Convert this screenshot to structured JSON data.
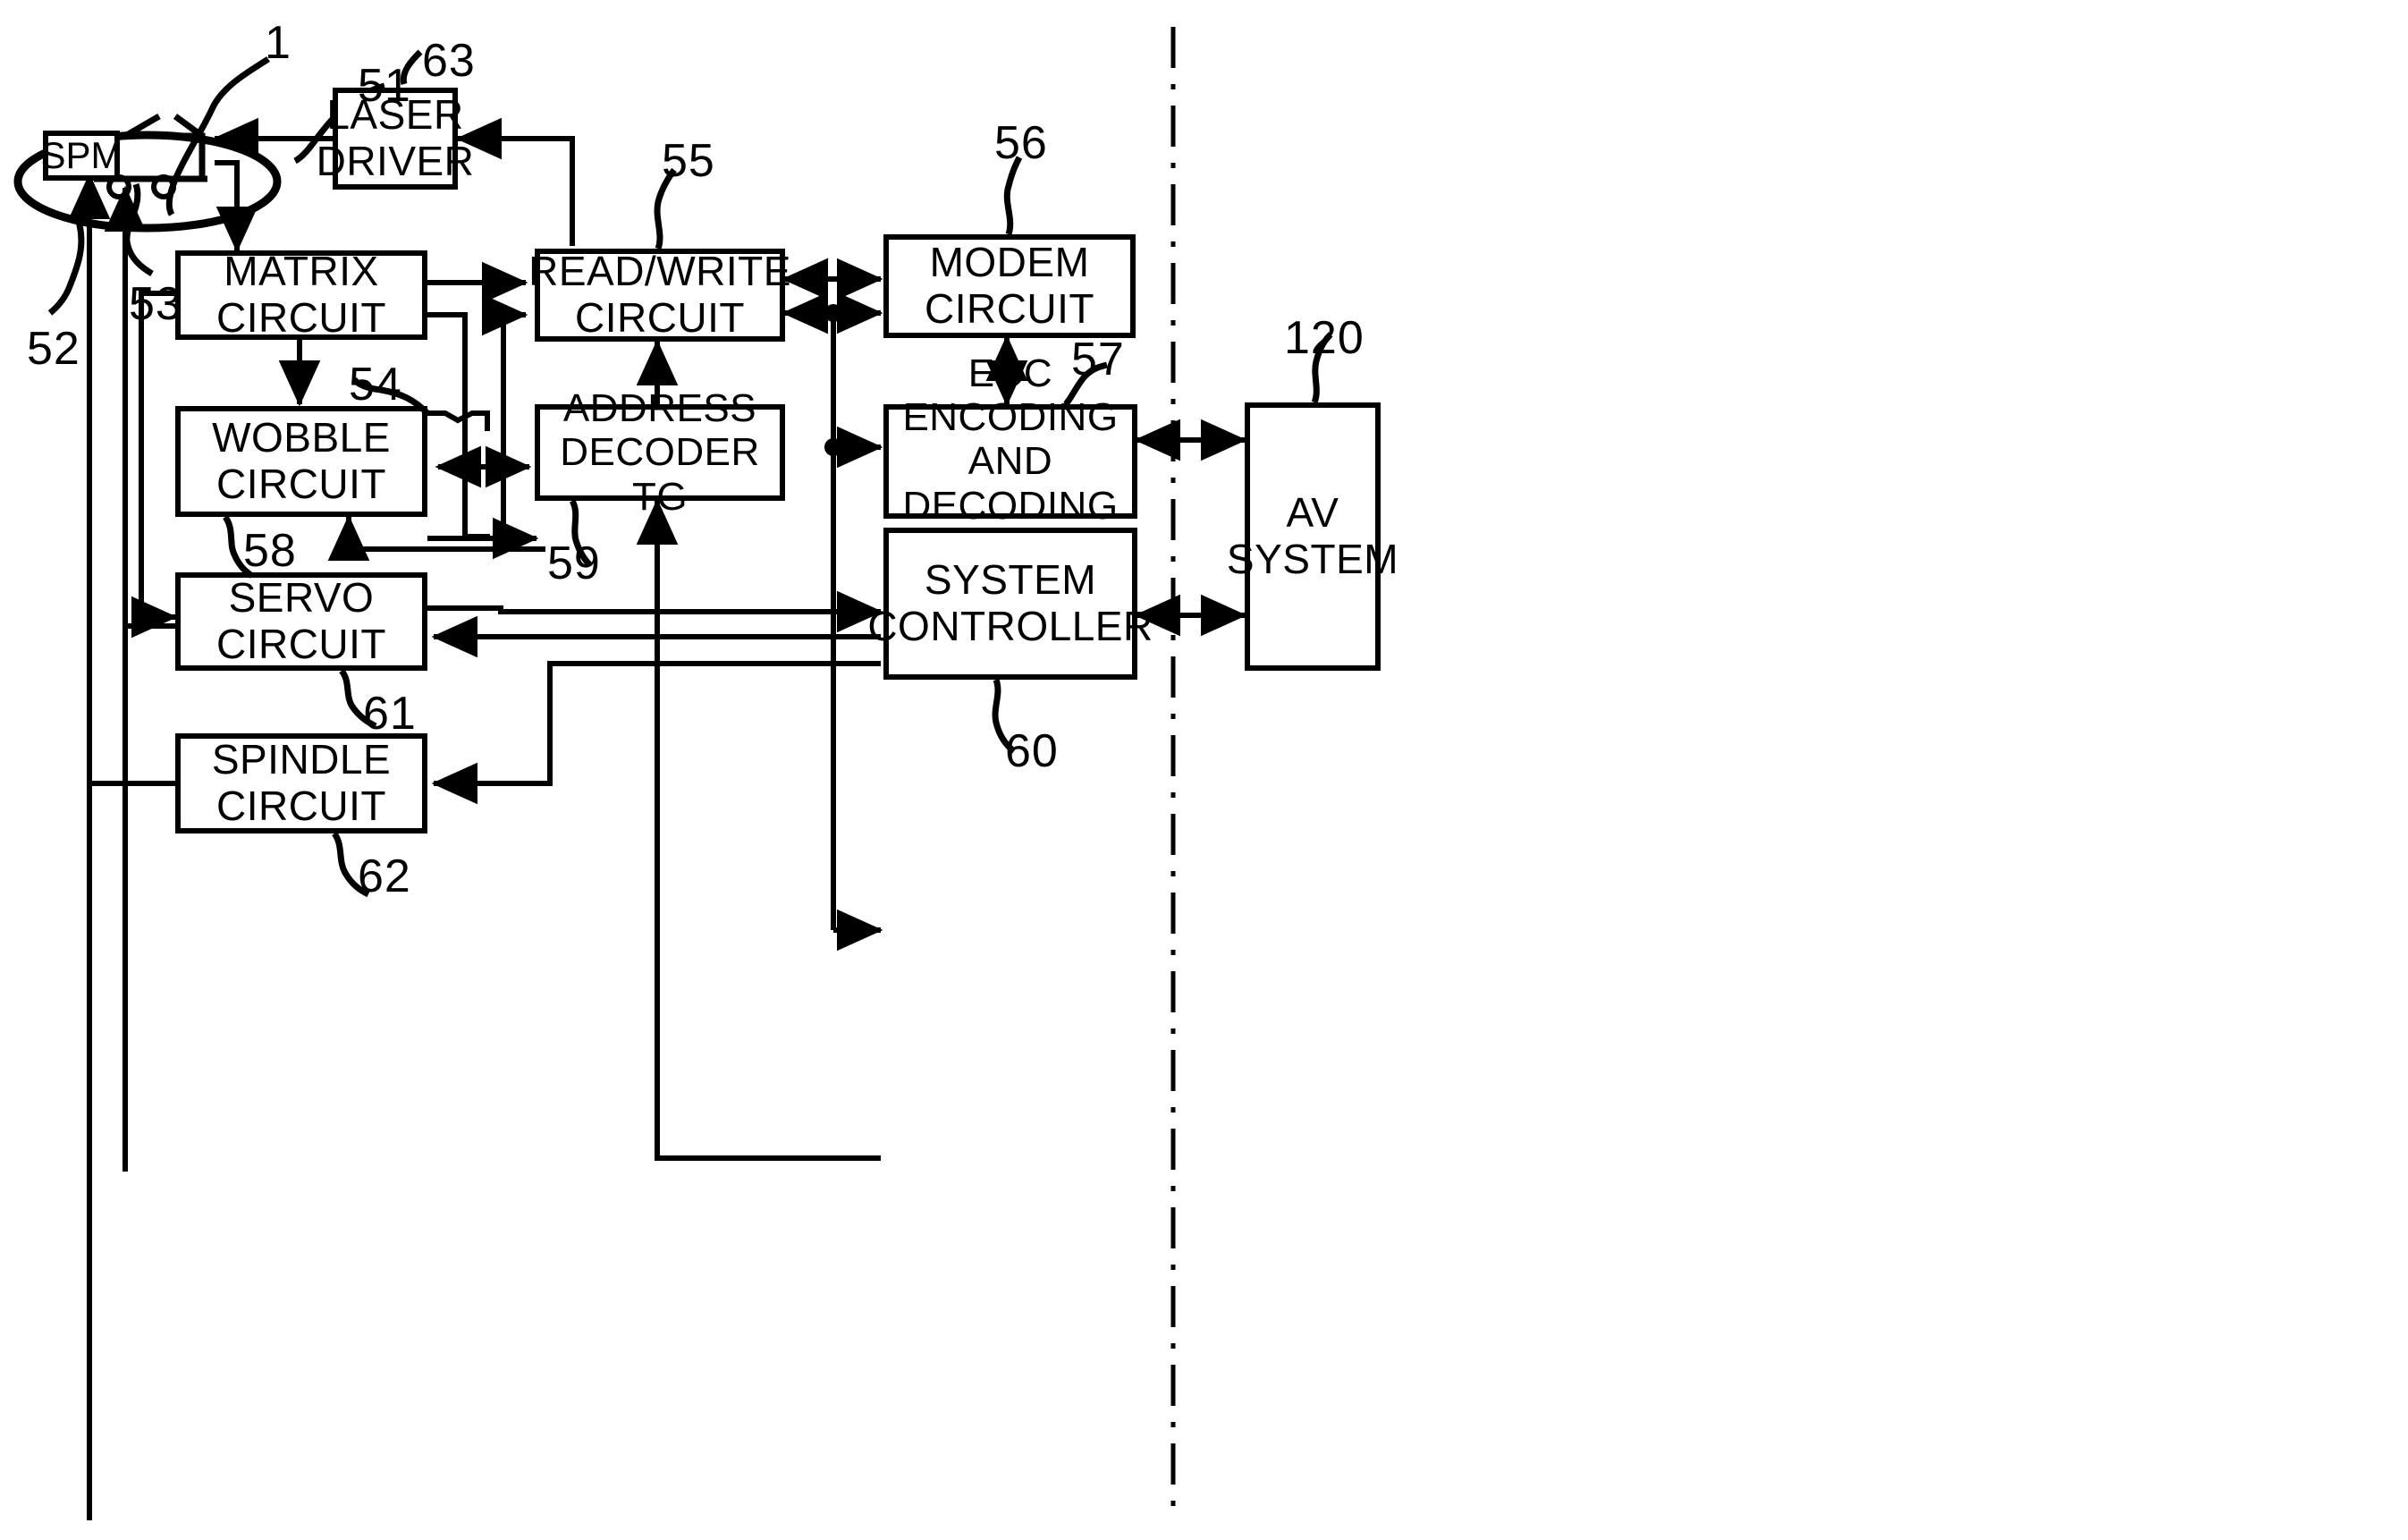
{
  "figure": {
    "type": "patent-block-diagram",
    "description": "Optical disc drive block diagram"
  },
  "blocks": [
    {
      "id": "spm",
      "label": "SPM"
    },
    {
      "id": "laser",
      "label": "LASER\nDRIVER"
    },
    {
      "id": "matrix",
      "label": "MATRIX\nCIRCUIT"
    },
    {
      "id": "readwrite",
      "label": "READ/WRITE\nCIRCUIT"
    },
    {
      "id": "modem",
      "label": "MODEM\nCIRCUIT"
    },
    {
      "id": "wobble",
      "label": "WOBBLE\nCIRCUIT"
    },
    {
      "id": "address",
      "label": "ADDRESS\nDECODER\nTG"
    },
    {
      "id": "ecc",
      "label": "ECC ENCODING\nAND\nDECODING\nCIRCUIT"
    },
    {
      "id": "servo",
      "label": "SERVO\nCIRCUIT"
    },
    {
      "id": "syscon",
      "label": "SYSTEM\nCONTROLLER"
    },
    {
      "id": "spindle",
      "label": "SPINDLE\nCIRCUIT"
    },
    {
      "id": "av",
      "label": "AV\nSYSTEM"
    }
  ],
  "reference_numerals": [
    {
      "id": "ref-1",
      "value": "1"
    },
    {
      "id": "ref-51",
      "value": "51"
    },
    {
      "id": "ref-52",
      "value": "52"
    },
    {
      "id": "ref-53",
      "value": "53"
    },
    {
      "id": "ref-54",
      "value": "54"
    },
    {
      "id": "ref-55",
      "value": "55"
    },
    {
      "id": "ref-56",
      "value": "56"
    },
    {
      "id": "ref-57",
      "value": "57"
    },
    {
      "id": "ref-58",
      "value": "58"
    },
    {
      "id": "ref-59",
      "value": "59"
    },
    {
      "id": "ref-60",
      "value": "60"
    },
    {
      "id": "ref-61",
      "value": "61"
    },
    {
      "id": "ref-62",
      "value": "62"
    },
    {
      "id": "ref-63",
      "value": "63"
    },
    {
      "id": "ref-120",
      "value": "120"
    }
  ],
  "colors": {
    "stroke": "#000000",
    "background": "#ffffff"
  }
}
